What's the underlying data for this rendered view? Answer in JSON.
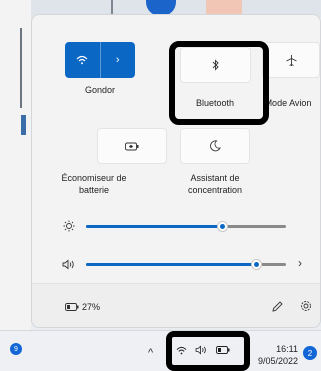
{
  "quick_settings": {
    "wifi": {
      "label": "Gondor",
      "icon": "wifi-icon",
      "state": "on",
      "accent": "#0a67c4"
    },
    "bluetooth": {
      "label": "Bluetooth",
      "icon": "bluetooth-icon",
      "state": "off"
    },
    "airplane": {
      "label": "Mode Avion",
      "icon": "airplane-icon",
      "state": "off"
    },
    "battery_saver": {
      "label": "Économiseur de batterie",
      "icon": "battery-saver-icon",
      "state": "off"
    },
    "focus_assist": {
      "label": "Assistant de concentration",
      "icon": "moon-icon",
      "state": "off"
    },
    "brightness": {
      "icon": "brightness-icon",
      "level": 0.68
    },
    "volume": {
      "icon": "speaker-icon",
      "level": 0.85
    },
    "battery_percent": "27%",
    "edit_icon": "pencil-icon",
    "settings_icon": "gear-icon"
  },
  "taskbar": {
    "app_badge_count": "9",
    "tray_icons": [
      "chevron-up-icon",
      "wifi-icon",
      "speaker-icon",
      "battery-icon"
    ],
    "time": "16:11",
    "date": "9/05/2022",
    "notification_count": "2"
  }
}
